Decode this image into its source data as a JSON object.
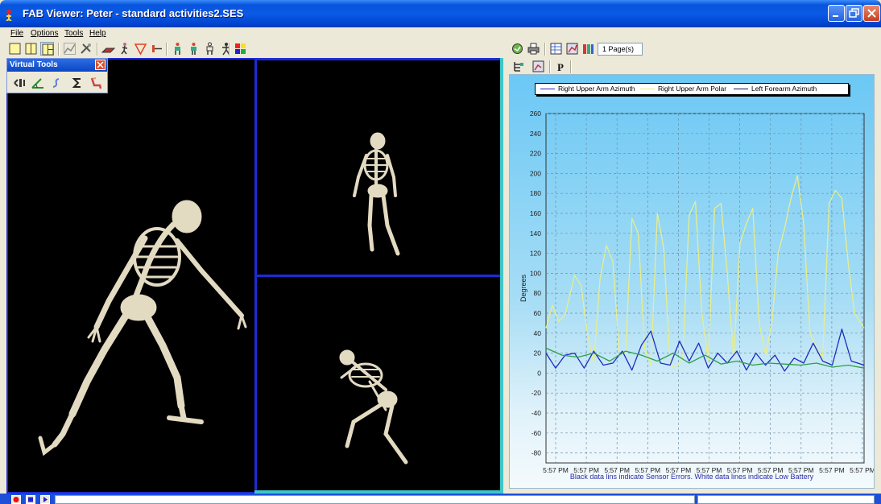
{
  "window": {
    "title": "FAB Viewer: Peter - standard activities2.SES",
    "icon": "fab-app-icon"
  },
  "menu": {
    "items": [
      {
        "label": "File"
      },
      {
        "label": "Options"
      },
      {
        "label": "Tools"
      },
      {
        "label": "Help"
      }
    ]
  },
  "toolbar": {
    "icons": [
      "single-view-icon",
      "two-view-icon",
      "four-view-icon",
      "chart-icon",
      "tools-icon",
      "floor-icon",
      "figure-icon",
      "triangle-icon",
      "joint-icon",
      "body-front-icon",
      "body-side-icon",
      "body-back-icon",
      "walk-icon",
      "color-palette-icon"
    ]
  },
  "virtual_tools": {
    "title": "Virtual Tools",
    "icons": [
      "angle-gauge-icon",
      "protractor-icon",
      "curve-icon",
      "sigma-icon",
      "seat-icon"
    ]
  },
  "chart_toolbar": {
    "page_count": "1 Page(s)",
    "icons": [
      "refresh-icon",
      "print-icon",
      "data-grid-icon",
      "chart-settings-icon",
      "color-bars-icon",
      "tree-icon",
      "graph-edit-icon",
      "p-icon"
    ]
  },
  "colors": {
    "series_blue": "#1F2BBF",
    "series_yellow": "#E8EE8A",
    "series_navy": "#07176E",
    "series_green": "#2E9E45",
    "viewport_border": "#1E2BD4",
    "viewport_border_active": "#3FC6C8"
  },
  "chart_data": {
    "type": "line",
    "ylabel": "Degrees",
    "ylim": [
      -90,
      260
    ],
    "yticks": [
      260,
      240,
      220,
      200,
      180,
      160,
      140,
      120,
      100,
      80,
      60,
      40,
      20,
      0,
      -20,
      -40,
      -60,
      -80
    ],
    "xticks": [
      "5:57 PM",
      "5:57 PM",
      "5:57 PM",
      "5:57 PM",
      "5:57 PM",
      "5:57 PM",
      "5:57 PM",
      "5:57 PM",
      "5:57 PM",
      "5:57 PM",
      "5:57 PM"
    ],
    "grid": true,
    "legend_position": "top",
    "legend": [
      "Right Upper Arm Azimuth",
      "Right Upper Arm Polar",
      "Left Forearm Azimuth"
    ],
    "footnote": "Black data lins indicate Sensor Errors.  White data lines indicate Low Battery",
    "series": [
      {
        "name": "Right Upper Arm Polar",
        "color": "#E8EE8A",
        "x": [
          0,
          0.02,
          0.04,
          0.06,
          0.09,
          0.11,
          0.13,
          0.15,
          0.17,
          0.19,
          0.21,
          0.23,
          0.25,
          0.27,
          0.29,
          0.31,
          0.33,
          0.35,
          0.37,
          0.39,
          0.41,
          0.43,
          0.45,
          0.47,
          0.49,
          0.51,
          0.53,
          0.55,
          0.57,
          0.59,
          0.61,
          0.63,
          0.65,
          0.67,
          0.69,
          0.71,
          0.73,
          0.75,
          0.77,
          0.79,
          0.81,
          0.83,
          0.85,
          0.87,
          0.89,
          0.91,
          0.93,
          0.95,
          0.97,
          1
        ],
        "values": [
          45,
          68,
          52,
          58,
          98,
          88,
          40,
          10,
          95,
          128,
          112,
          22,
          20,
          155,
          140,
          25,
          8,
          160,
          125,
          8,
          5,
          15,
          158,
          172,
          60,
          12,
          165,
          170,
          100,
          15,
          130,
          150,
          165,
          50,
          18,
          50,
          120,
          145,
          175,
          198,
          150,
          40,
          25,
          15,
          170,
          183,
          175,
          110,
          60,
          45
        ]
      },
      {
        "name": "Right Upper Arm Azimuth",
        "color": "#1F2BBF",
        "x": [
          0,
          0.03,
          0.06,
          0.09,
          0.12,
          0.15,
          0.18,
          0.21,
          0.24,
          0.27,
          0.3,
          0.33,
          0.36,
          0.39,
          0.42,
          0.45,
          0.48,
          0.51,
          0.54,
          0.57,
          0.6,
          0.63,
          0.66,
          0.69,
          0.72,
          0.75,
          0.78,
          0.81,
          0.84,
          0.87,
          0.9,
          0.93,
          0.96,
          1
        ],
        "values": [
          20,
          5,
          18,
          20,
          5,
          22,
          8,
          10,
          22,
          3,
          28,
          42,
          10,
          8,
          32,
          12,
          30,
          5,
          20,
          10,
          22,
          3,
          20,
          8,
          18,
          2,
          15,
          10,
          30,
          12,
          8,
          44,
          12,
          8
        ]
      },
      {
        "name": "Left Forearm Azimuth",
        "color": "#2E9E45",
        "x": [
          0,
          0.05,
          0.1,
          0.15,
          0.2,
          0.25,
          0.3,
          0.35,
          0.4,
          0.45,
          0.5,
          0.55,
          0.6,
          0.65,
          0.7,
          0.75,
          0.8,
          0.85,
          0.9,
          0.95,
          1
        ],
        "values": [
          25,
          18,
          16,
          20,
          12,
          22,
          18,
          12,
          20,
          10,
          18,
          9,
          12,
          8,
          10,
          9,
          8,
          10,
          6,
          8,
          5
        ]
      }
    ]
  }
}
